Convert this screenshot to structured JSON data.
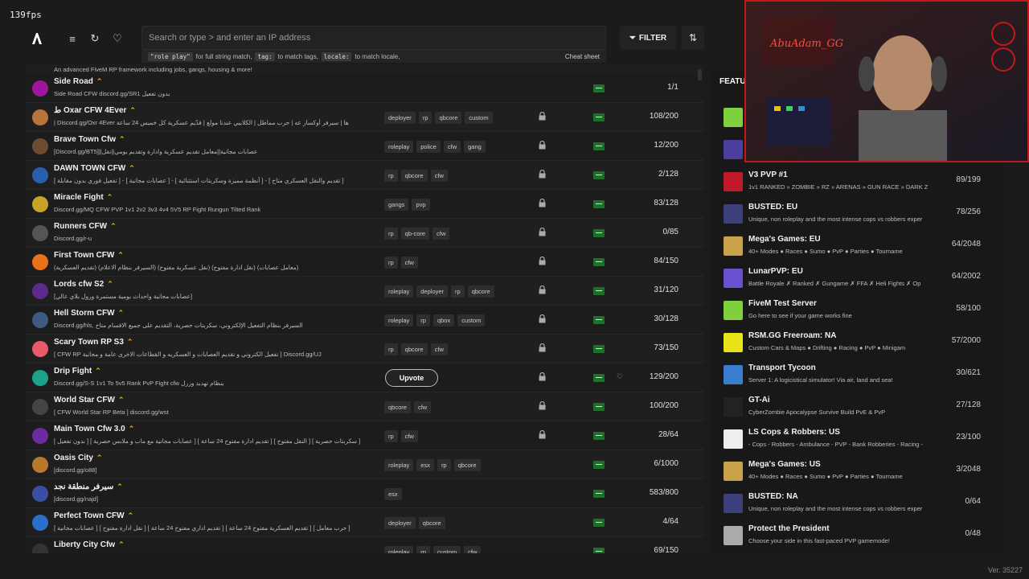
{
  "fps": "139fps",
  "search": {
    "placeholder": "Search or type > and enter an IP address"
  },
  "hint": {
    "code1": "\"role play\"",
    "text1": "for full string match,",
    "code2": "tag:",
    "text2": "to match tags,",
    "code3": "locale:",
    "text3": "to match locale,",
    "cheat": "Cheat sheet"
  },
  "filter_label": "FILTER",
  "top_fragment": "An advanced FiveM RP framework including jobs, gangs, housing & more!",
  "servers": [
    {
      "name": "Side Road",
      "desc": "Side Road CFW discord.gg/SR1 بدون تفعيل",
      "tags": [],
      "locked": false,
      "players": "1/1",
      "icon_color": "#a0159e"
    },
    {
      "name": "ﻁ Oxar CFW 4Ever",
      "desc": "| Discord.gg/Oxr 4Ever ها | سيرفر أوكسار عه | حرب مماطل | الكلابيي عندنا مولع | قدّيم عسكرية كل خميس 24 ساعة",
      "tags": [
        "deployer",
        "rp",
        "qbcore",
        "custom"
      ],
      "locked": true,
      "players": "108/200",
      "icon_color": "#b8743a"
    },
    {
      "name": "Brave Town Cfw",
      "desc": "[Discord.gg/BT5]||عصابات مجانية||معامل تقديم عسكرية وادارة وتقديم يومي||نقل",
      "tags": [
        "roleplay",
        "police",
        "cfw",
        "gang"
      ],
      "locked": true,
      "players": "12/200",
      "icon_color": "#6d4c2f"
    },
    {
      "name": "DAWN TOWN CFW",
      "desc": "[ تفعيل فوري بدون مقابلة ] - [ عصابات مجانية ] - [ أنظمة مميزة وسكربتات استثنائية ] - [ تقديم والنقل العسكري متاح ]",
      "tags": [
        "rp",
        "qbcore",
        "cfw"
      ],
      "locked": true,
      "players": "2/128",
      "icon_color": "#2a5fb0"
    },
    {
      "name": "Miracle Fight",
      "desc": "Discord.gg/MQ CFW PVP 1v1 2v2 3v3 4v4 5V5 RP Fight Rungun Tilted Rank",
      "tags": [
        "gangs",
        "pvp"
      ],
      "locked": true,
      "players": "83/128",
      "icon_color": "#c9a227"
    },
    {
      "name": "Runners CFW",
      "desc": "Discord.gg/r-u",
      "tags": [
        "rp",
        "qb-core",
        "cfw"
      ],
      "locked": true,
      "players": "0/85",
      "icon_color": "#555"
    },
    {
      "name": "First Town CFW",
      "desc": "(تقديم العسكرية) (السيرفر بنظام الاعلام) (نقل عسكرية مفتوح) (نقل ادارة مفتوح) (معامل عصابات)",
      "tags": [
        "rp",
        "cfw"
      ],
      "locked": true,
      "players": "84/150",
      "icon_color": "#e8711a"
    },
    {
      "name": "Lords cfw S2",
      "desc": "[عصابات مجانية واحداث يومية مستمرة ورول بلاي عالي]",
      "tags": [
        "roleplay",
        "deployer",
        "rp",
        "qbcore"
      ],
      "locked": true,
      "players": "31/120",
      "icon_color": "#5b2a8c"
    },
    {
      "name": "Hell Storm CFW",
      "desc": "Discord.gg/hls, السيرفر بنظام التفعيل الإلكتروني، سكربتات حصرية، التقديم على جميع الاقسام متاح",
      "tags": [
        "roleplay",
        "rp",
        "qbox",
        "custom"
      ],
      "locked": true,
      "players": "30/128",
      "icon_color": "#3d5a80"
    },
    {
      "name": "Scary Town RP S3",
      "desc": "[ CFW RP تفعيل الكتروني و تقديم العصابات و العسكريه و القطاعات الاخرى عامة و مجانية ] Discord.gg/UJ",
      "tags": [
        "rp",
        "qbcore",
        "cfw"
      ],
      "locked": true,
      "players": "73/150",
      "icon_color": "#e85a6a"
    },
    {
      "name": "Drip Fight",
      "desc": "Discord.gg/S-S 1v1 To 5v5 Rank PvP Fight cfw بنظام تهديد وزرل",
      "tags": [],
      "locked": true,
      "players": "129/200",
      "icon_color": "#1aa38a",
      "upvote": "Upvote",
      "heart": true
    },
    {
      "name": "World Star CFW",
      "desc": "[ CFW World Star RP Beta ] discord.gg/wst",
      "tags": [
        "qbcore",
        "cfw"
      ],
      "locked": true,
      "players": "100/200",
      "icon_color": "#444"
    },
    {
      "name": "Main Town Cfw 3.0",
      "desc": "[ بدون تفعيل ] [ عصابات مجانية مع ماب و ملابس حصرية ] [ تقديم ادارة مفتوح 24 ساعة ] [ النقل مفتوح ] [ سكربتات حصرية ]",
      "tags": [
        "rp",
        "cfw"
      ],
      "locked": true,
      "players": "28/64",
      "icon_color": "#6a2ba0"
    },
    {
      "name": "Oasis City",
      "desc": "[discord.gg/o88]",
      "tags": [
        "roleplay",
        "esx",
        "rp",
        "qbcore"
      ],
      "locked": false,
      "players": "6/1000",
      "icon_color": "#b87a2a"
    },
    {
      "name": "سيرفر منطقة نجد",
      "desc": "[discord.gg/najd]",
      "tags": [
        "esx"
      ],
      "locked": false,
      "players": "583/800",
      "icon_color": "#3a4fa0"
    },
    {
      "name": "Perfect Town CFW",
      "desc": "[ عصابات مجانية ] [ نقل ادارة مفتوح ] [ تقديم اداري مفتوح 24 ساعة ] [ تقديم العسكرية مفتوح 24 ساعة ] [ حرب معامل ]",
      "tags": [
        "deployer",
        "qbcore"
      ],
      "locked": false,
      "players": "4/64",
      "icon_color": "#2a6fc9"
    },
    {
      "name": "Liberty City Cfw",
      "desc": "",
      "tags": [
        "roleplay",
        "rp",
        "custom",
        "cfw"
      ],
      "locked": false,
      "players": "69/150",
      "icon_color": "#333"
    }
  ],
  "featured": {
    "title": "FEATU",
    "items": [
      {
        "name": "",
        "desc": "",
        "players": "",
        "icon_color": "#7fd13b"
      },
      {
        "name": "",
        "desc": "",
        "players": "",
        "icon_color": "#4a3f9e"
      },
      {
        "name": "V3 PVP #1",
        "desc": "1v1 RANKED » ZOMBIE » RZ » ARENAS » GUN RACE » DARK Z",
        "players": "89/199",
        "icon_color": "#c01a2a"
      },
      {
        "name": "BUSTED: EU",
        "desc": "Unique, non roleplay and the most intense cops vs robbers exper",
        "players": "78/256",
        "icon_color": "#3b3f7a"
      },
      {
        "name": "Mega's Games: EU",
        "desc": "40+ Modes ● Races ● Sumo ● PvP ● Parties ● Tourname",
        "players": "64/2048",
        "icon_color": "#c9a24a"
      },
      {
        "name": "LunarPVP: EU",
        "desc": "Battle Royale ✗ Ranked ✗ Gungame ✗ FFA ✗ Heli Fights ✗ Op",
        "players": "64/2002",
        "icon_color": "#6a4fd1"
      },
      {
        "name": "FiveM Test Server",
        "desc": "Go here to see if your game works fine",
        "players": "58/100",
        "icon_color": "#7fd13b"
      },
      {
        "name": "RSM.GG Freeroam: NA",
        "desc": "Custom Cars & Maps ● Drifting ● Racing ● PvP ● Minigam",
        "players": "57/2000",
        "icon_color": "#e8e21a"
      },
      {
        "name": "Transport Tycoon",
        "desc": "Server 1: A logicistical simulator! Via air, land and sea!",
        "players": "30/621",
        "icon_color": "#3a7ed1"
      },
      {
        "name": "GT-Ai",
        "desc": "CyberZombie Apocalypse Survive Build PvE & PvP",
        "players": "27/128",
        "icon_color": "#222"
      },
      {
        "name": "LS Cops & Robbers: US",
        "desc": "- Cops - Robbers - Ambulance - PVP - Bank Robberies - Racing -",
        "players": "23/100",
        "icon_color": "#eee"
      },
      {
        "name": "Mega's Games: US",
        "desc": "40+ Modes ● Races ● Sumo ● PvP ● Parties ● Tourname",
        "players": "3/2048",
        "icon_color": "#c9a24a"
      },
      {
        "name": "BUSTED: NA",
        "desc": "Unique, non roleplay and the most intense cops vs robbers exper",
        "players": "0/64",
        "icon_color": "#3b3f7a"
      },
      {
        "name": "Protect the President",
        "desc": "Choose your side in this fast-paced PVP gamemode!",
        "players": "0/48",
        "icon_color": "#aaa"
      }
    ]
  },
  "webcam": {
    "sign_text": "AbuAdam_GG"
  },
  "version": "Ver. 35227"
}
